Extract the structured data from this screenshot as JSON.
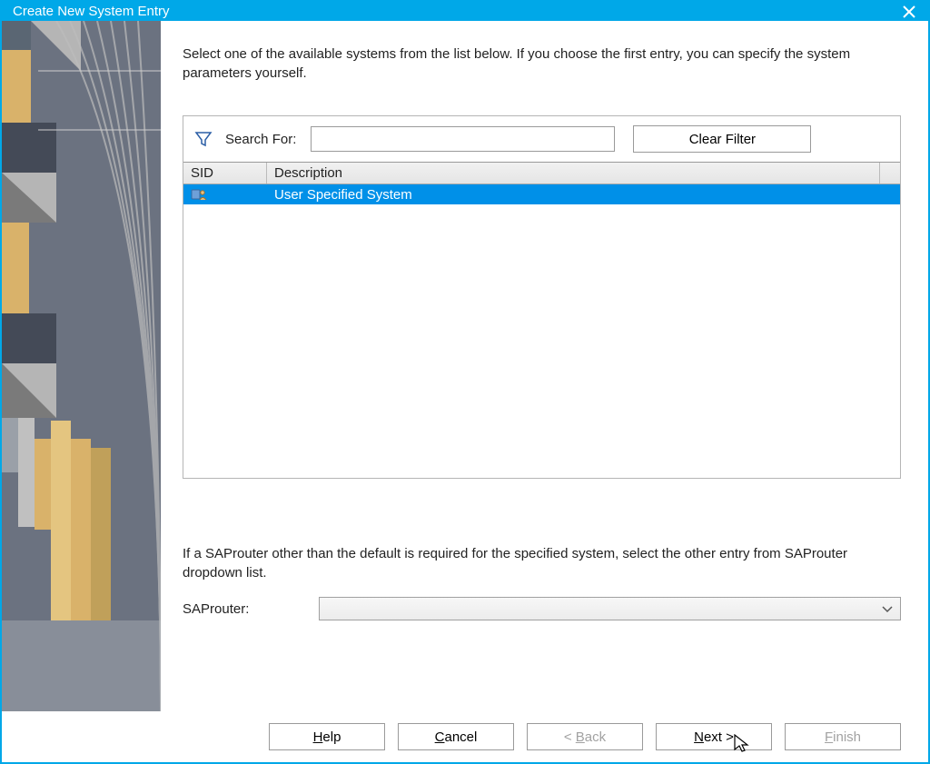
{
  "window": {
    "title": "Create New System Entry"
  },
  "intro": "Select one of the available systems from the list below. If you choose the first entry, you can specify the system parameters yourself.",
  "filter": {
    "label": "Search For:",
    "value": "",
    "clear_label": "Clear Filter"
  },
  "table": {
    "headers": {
      "sid": "SID",
      "desc": "Description"
    },
    "rows": [
      {
        "sid": "",
        "desc": "User Specified System",
        "selected": true
      }
    ]
  },
  "saprouter": {
    "note": "If a SAProuter other than the default is required for the specified system, select the other entry from SAProuter dropdown list.",
    "label": "SAProuter:",
    "value": ""
  },
  "footer": {
    "help": "Help",
    "cancel": "Cancel",
    "back": "< Back",
    "next": "Next >",
    "finish": "Finish"
  }
}
